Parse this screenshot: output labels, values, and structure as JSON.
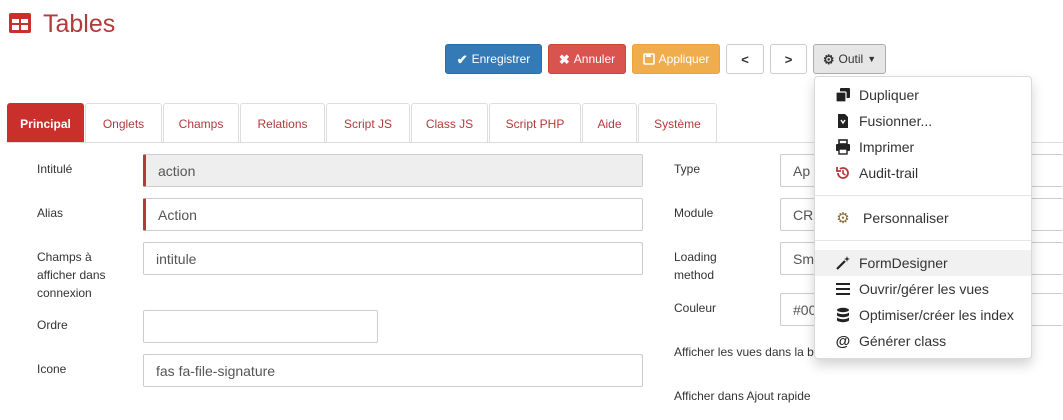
{
  "page": {
    "title": "Tables"
  },
  "toolbar": {
    "save_label": "Enregistrer",
    "cancel_label": "Annuler",
    "apply_label": "Appliquer",
    "prev_label": "<",
    "next_label": ">",
    "tools_label": "Outil"
  },
  "tabs": [
    {
      "label": "Principal",
      "active": true
    },
    {
      "label": "Onglets"
    },
    {
      "label": "Champs"
    },
    {
      "label": "Relations"
    },
    {
      "label": "Script JS"
    },
    {
      "label": "Class JS"
    },
    {
      "label": "Script PHP"
    },
    {
      "label": "Aide"
    },
    {
      "label": "Système"
    }
  ],
  "form": {
    "intitule": {
      "label": "Intitulé",
      "value": "action"
    },
    "alias": {
      "label": "Alias",
      "value": "Action"
    },
    "champs": {
      "label": "Champs à afficher dans connexion",
      "value": "intitule"
    },
    "ordre": {
      "label": "Ordre",
      "value": ""
    },
    "icone": {
      "label": "Icone",
      "value": "fas fa-file-signature"
    },
    "type": {
      "label": "Type",
      "value": "Ap"
    },
    "module": {
      "label": "Module",
      "value": "CR"
    },
    "loading": {
      "label": "Loading method",
      "value": "Sm"
    },
    "couleur": {
      "label": "Couleur",
      "value": "#00"
    },
    "afficher_vues": {
      "label": "Afficher les vues dans la b"
    },
    "ajout_rapide": {
      "label": "Afficher dans Ajout rapide"
    }
  },
  "tools_menu": {
    "items": [
      {
        "label": "Dupliquer",
        "icon": "copy-icon"
      },
      {
        "label": "Fusionner...",
        "icon": "file-merge-icon"
      },
      {
        "label": "Imprimer",
        "icon": "print-icon"
      },
      {
        "label": "Audit-trail",
        "icon": "history-icon"
      },
      {
        "label": "Personnaliser",
        "icon": "cog-icon"
      },
      {
        "label": "FormDesigner",
        "icon": "magic-wand-icon"
      },
      {
        "label": "Ouvrir/gérer les vues",
        "icon": "list-icon"
      },
      {
        "label": "Optimiser/créer les index",
        "icon": "database-icon"
      },
      {
        "label": "Générer class",
        "icon": "at-icon"
      }
    ]
  },
  "colors": {
    "brand": "#b23a3a",
    "primary": "#337ab7",
    "danger": "#d9534f",
    "warning": "#f0ad4e",
    "active_tab": "#c9302c"
  }
}
